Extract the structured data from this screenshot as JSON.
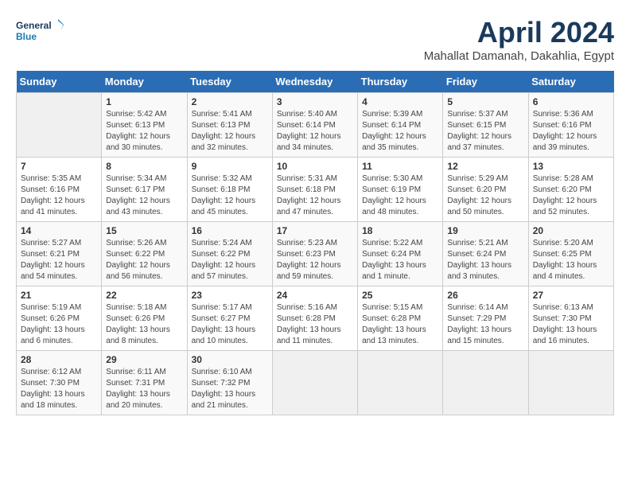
{
  "header": {
    "logo_line1": "General",
    "logo_line2": "Blue",
    "month": "April 2024",
    "location": "Mahallat Damanah, Dakahlia, Egypt"
  },
  "calendar": {
    "weekdays": [
      "Sunday",
      "Monday",
      "Tuesday",
      "Wednesday",
      "Thursday",
      "Friday",
      "Saturday"
    ],
    "weeks": [
      [
        {
          "day": "",
          "info": ""
        },
        {
          "day": "1",
          "info": "Sunrise: 5:42 AM\nSunset: 6:13 PM\nDaylight: 12 hours\nand 30 minutes."
        },
        {
          "day": "2",
          "info": "Sunrise: 5:41 AM\nSunset: 6:13 PM\nDaylight: 12 hours\nand 32 minutes."
        },
        {
          "day": "3",
          "info": "Sunrise: 5:40 AM\nSunset: 6:14 PM\nDaylight: 12 hours\nand 34 minutes."
        },
        {
          "day": "4",
          "info": "Sunrise: 5:39 AM\nSunset: 6:14 PM\nDaylight: 12 hours\nand 35 minutes."
        },
        {
          "day": "5",
          "info": "Sunrise: 5:37 AM\nSunset: 6:15 PM\nDaylight: 12 hours\nand 37 minutes."
        },
        {
          "day": "6",
          "info": "Sunrise: 5:36 AM\nSunset: 6:16 PM\nDaylight: 12 hours\nand 39 minutes."
        }
      ],
      [
        {
          "day": "7",
          "info": "Sunrise: 5:35 AM\nSunset: 6:16 PM\nDaylight: 12 hours\nand 41 minutes."
        },
        {
          "day": "8",
          "info": "Sunrise: 5:34 AM\nSunset: 6:17 PM\nDaylight: 12 hours\nand 43 minutes."
        },
        {
          "day": "9",
          "info": "Sunrise: 5:32 AM\nSunset: 6:18 PM\nDaylight: 12 hours\nand 45 minutes."
        },
        {
          "day": "10",
          "info": "Sunrise: 5:31 AM\nSunset: 6:18 PM\nDaylight: 12 hours\nand 47 minutes."
        },
        {
          "day": "11",
          "info": "Sunrise: 5:30 AM\nSunset: 6:19 PM\nDaylight: 12 hours\nand 48 minutes."
        },
        {
          "day": "12",
          "info": "Sunrise: 5:29 AM\nSunset: 6:20 PM\nDaylight: 12 hours\nand 50 minutes."
        },
        {
          "day": "13",
          "info": "Sunrise: 5:28 AM\nSunset: 6:20 PM\nDaylight: 12 hours\nand 52 minutes."
        }
      ],
      [
        {
          "day": "14",
          "info": "Sunrise: 5:27 AM\nSunset: 6:21 PM\nDaylight: 12 hours\nand 54 minutes."
        },
        {
          "day": "15",
          "info": "Sunrise: 5:26 AM\nSunset: 6:22 PM\nDaylight: 12 hours\nand 56 minutes."
        },
        {
          "day": "16",
          "info": "Sunrise: 5:24 AM\nSunset: 6:22 PM\nDaylight: 12 hours\nand 57 minutes."
        },
        {
          "day": "17",
          "info": "Sunrise: 5:23 AM\nSunset: 6:23 PM\nDaylight: 12 hours\nand 59 minutes."
        },
        {
          "day": "18",
          "info": "Sunrise: 5:22 AM\nSunset: 6:24 PM\nDaylight: 13 hours\nand 1 minute."
        },
        {
          "day": "19",
          "info": "Sunrise: 5:21 AM\nSunset: 6:24 PM\nDaylight: 13 hours\nand 3 minutes."
        },
        {
          "day": "20",
          "info": "Sunrise: 5:20 AM\nSunset: 6:25 PM\nDaylight: 13 hours\nand 4 minutes."
        }
      ],
      [
        {
          "day": "21",
          "info": "Sunrise: 5:19 AM\nSunset: 6:26 PM\nDaylight: 13 hours\nand 6 minutes."
        },
        {
          "day": "22",
          "info": "Sunrise: 5:18 AM\nSunset: 6:26 PM\nDaylight: 13 hours\nand 8 minutes."
        },
        {
          "day": "23",
          "info": "Sunrise: 5:17 AM\nSunset: 6:27 PM\nDaylight: 13 hours\nand 10 minutes."
        },
        {
          "day": "24",
          "info": "Sunrise: 5:16 AM\nSunset: 6:28 PM\nDaylight: 13 hours\nand 11 minutes."
        },
        {
          "day": "25",
          "info": "Sunrise: 5:15 AM\nSunset: 6:28 PM\nDaylight: 13 hours\nand 13 minutes."
        },
        {
          "day": "26",
          "info": "Sunrise: 6:14 AM\nSunset: 7:29 PM\nDaylight: 13 hours\nand 15 minutes."
        },
        {
          "day": "27",
          "info": "Sunrise: 6:13 AM\nSunset: 7:30 PM\nDaylight: 13 hours\nand 16 minutes."
        }
      ],
      [
        {
          "day": "28",
          "info": "Sunrise: 6:12 AM\nSunset: 7:30 PM\nDaylight: 13 hours\nand 18 minutes."
        },
        {
          "day": "29",
          "info": "Sunrise: 6:11 AM\nSunset: 7:31 PM\nDaylight: 13 hours\nand 20 minutes."
        },
        {
          "day": "30",
          "info": "Sunrise: 6:10 AM\nSunset: 7:32 PM\nDaylight: 13 hours\nand 21 minutes."
        },
        {
          "day": "",
          "info": ""
        },
        {
          "day": "",
          "info": ""
        },
        {
          "day": "",
          "info": ""
        },
        {
          "day": "",
          "info": ""
        }
      ]
    ]
  }
}
